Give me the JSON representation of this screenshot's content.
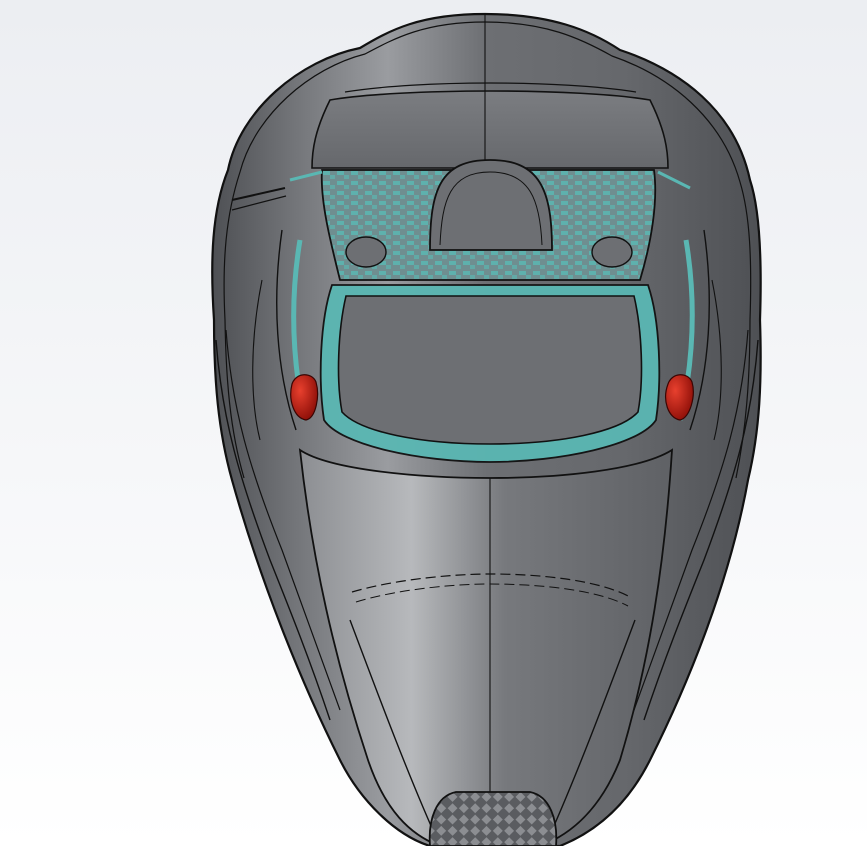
{
  "viewport": {
    "background_top": "#eceef2",
    "background_mid": "#f6f7f9",
    "background_bottom": "#ffffff"
  },
  "model": {
    "body_color": "#6d6f73",
    "body_highlight": "#9a9ca0",
    "body_shadow": "#4e5054",
    "edge_color": "#111111",
    "glass_color": "#5ab7b3",
    "light_color": "#c01a10",
    "light_highlight": "#e8402e",
    "grille_color": "#5a5c60"
  },
  "parts": [
    {
      "name": "outer-body-shell"
    },
    {
      "name": "roof-panel"
    },
    {
      "name": "rear-window"
    },
    {
      "name": "cockpit-opening"
    },
    {
      "name": "left-mirror"
    },
    {
      "name": "right-mirror"
    },
    {
      "name": "front-nose-grille"
    }
  ]
}
